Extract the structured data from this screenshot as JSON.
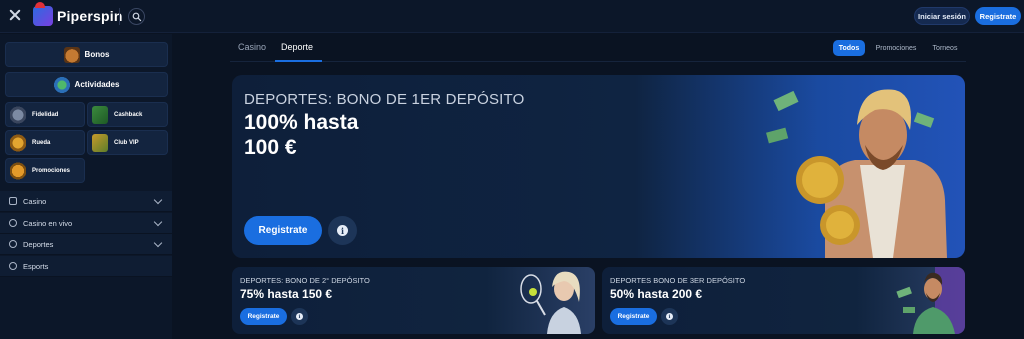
{
  "header": {
    "brand": "Piperspin",
    "login_label": "Iniciar sesión",
    "register_label": "Registrate"
  },
  "sidebar": {
    "featured": [
      {
        "label": "Bonos",
        "icon": "treasure-chest-icon"
      },
      {
        "label": "Actividades",
        "icon": "activities-icon"
      }
    ],
    "grid": [
      {
        "label": "Fidelidad",
        "icon": "loyalty-icon"
      },
      {
        "label": "Cashback",
        "icon": "cashback-icon"
      },
      {
        "label": "Rueda",
        "icon": "wheel-icon"
      },
      {
        "label": "Club VIP",
        "icon": "vip-icon"
      },
      {
        "label": "Promociones",
        "icon": "promotions-icon"
      }
    ],
    "nav": [
      {
        "label": "Casino",
        "icon": "casino-icon",
        "expandable": true
      },
      {
        "label": "Casino en vivo",
        "icon": "live-icon",
        "expandable": true
      },
      {
        "label": "Deportes",
        "icon": "sports-icon",
        "expandable": true
      },
      {
        "label": "Esports",
        "icon": "esports-icon",
        "expandable": false
      }
    ]
  },
  "main": {
    "tabs": [
      {
        "label": "Casino",
        "active": false
      },
      {
        "label": "Deporte",
        "active": true
      }
    ],
    "filters": [
      {
        "label": "Todos",
        "active": true
      },
      {
        "label": "Promociones",
        "active": false
      },
      {
        "label": "Torneos",
        "active": false
      }
    ],
    "hero": {
      "subtitle": "DEPORTES: BONO DE 1ER DEPÓSITO",
      "title_line1": "100% hasta",
      "title_line2": "100 €",
      "button": "Registrate"
    },
    "cards": [
      {
        "subtitle": "DEPORTES: BONO DE 2° DEPÓSITO",
        "title": "75% hasta 150 €",
        "button": "Registrate"
      },
      {
        "subtitle": "DEPORTES BONO DE 3ER DEPÓSITO",
        "title": "50% hasta 200 €",
        "button": "Registrate"
      }
    ]
  },
  "colors": {
    "background": "#0a1322",
    "panel": "#13243f",
    "accent": "#1a6ee0"
  }
}
